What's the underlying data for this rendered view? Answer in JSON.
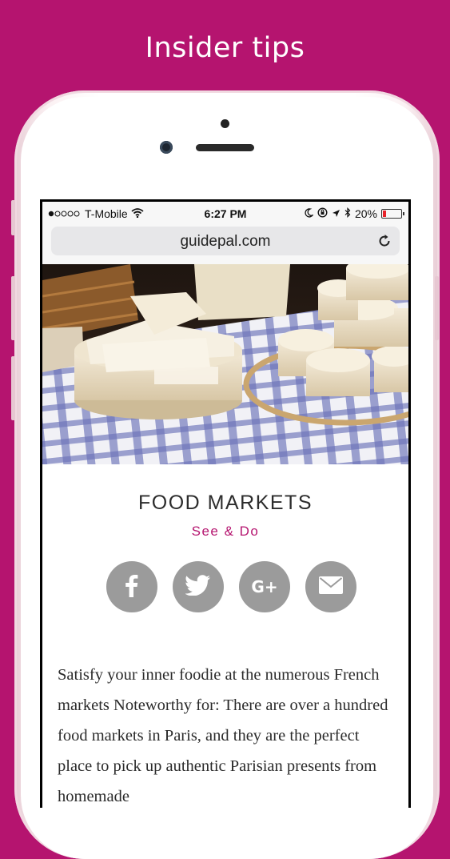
{
  "promo": {
    "headline": "Insider tips"
  },
  "status_bar": {
    "carrier": "T-Mobile",
    "time": "6:27 PM",
    "battery": "20%",
    "battery_level": 0.2,
    "signal_icons": [
      "signal-dots-icon",
      "wifi-icon",
      "moon-icon",
      "rotation-lock-icon",
      "location-arrow-icon",
      "bluetooth-icon",
      "battery-icon"
    ]
  },
  "browser": {
    "url": "guidepal.com",
    "reload_icon": "reload-icon"
  },
  "article": {
    "title": "FOOD MARKETS",
    "category": "See & Do",
    "share_buttons": [
      {
        "name": "facebook",
        "icon": "facebook-icon"
      },
      {
        "name": "twitter",
        "icon": "twitter-icon"
      },
      {
        "name": "google-plus",
        "icon": "google-plus-icon",
        "label": "G+"
      },
      {
        "name": "email",
        "icon": "email-icon"
      }
    ],
    "body": "Satisfy your inner foodie at the numerous French markets Noteworthy for: There are over a hundred food markets in Paris, and they are the perfect place to pick up authentic Parisian presents from homemade"
  },
  "colors": {
    "brand": "#b5146f",
    "share_button": "#9b9b9b",
    "battery_low": "#e8232b"
  }
}
